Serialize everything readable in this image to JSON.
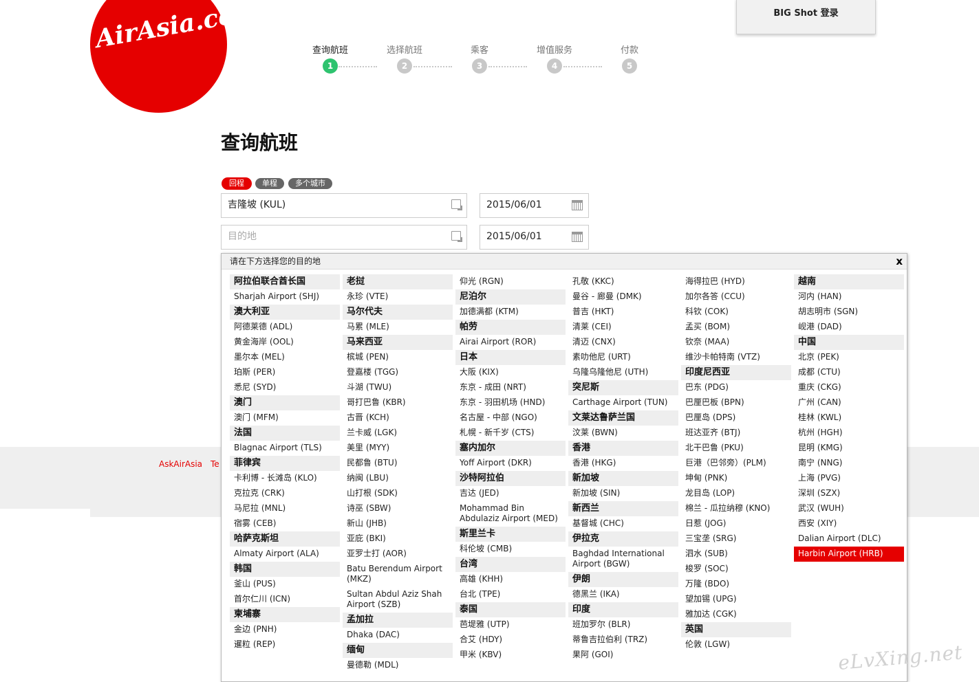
{
  "logo_text": "AirAsia.com",
  "big_shot_button": "BIG Shot 登录",
  "steps": [
    {
      "label": "查询航班",
      "num": "1",
      "active": true
    },
    {
      "label": "选择航班",
      "num": "2",
      "active": false
    },
    {
      "label": "乘客",
      "num": "3",
      "active": false
    },
    {
      "label": "增值服务",
      "num": "4",
      "active": false
    },
    {
      "label": "付款",
      "num": "5",
      "active": false
    }
  ],
  "page_title": "查询航班",
  "trip_types": [
    {
      "label": "回程",
      "active": true
    },
    {
      "label": "单程",
      "active": false
    },
    {
      "label": "多个城市",
      "active": false
    }
  ],
  "origin_value": "吉隆坡 (KUL)",
  "destination_placeholder": "目的地",
  "depart_date": "2015/06/01",
  "return_date": "2015/06/01",
  "footer_links": [
    "AskAirAsia",
    "Te"
  ],
  "dropdown": {
    "header": "请在下方选择您的目的地",
    "close": "x",
    "columns": [
      [
        {
          "text": "阿拉伯联合酋长国",
          "type": "country"
        },
        {
          "text": "Sharjah Airport (SHJ)",
          "type": "city"
        },
        {
          "text": "澳大利亚",
          "type": "country"
        },
        {
          "text": "阿德莱德 (ADL)",
          "type": "city"
        },
        {
          "text": "黄金海岸 (OOL)",
          "type": "city"
        },
        {
          "text": "墨尔本 (MEL)",
          "type": "city"
        },
        {
          "text": "珀斯 (PER)",
          "type": "city"
        },
        {
          "text": "悉尼 (SYD)",
          "type": "city"
        },
        {
          "text": "澳门",
          "type": "country"
        },
        {
          "text": "澳门 (MFM)",
          "type": "city"
        },
        {
          "text": "法国",
          "type": "country"
        },
        {
          "text": "Blagnac Airport (TLS)",
          "type": "city"
        },
        {
          "text": "菲律宾",
          "type": "country"
        },
        {
          "text": "卡利博 - 长滩岛 (KLO)",
          "type": "city"
        },
        {
          "text": "克拉克 (CRK)",
          "type": "city"
        },
        {
          "text": "马尼拉 (MNL)",
          "type": "city"
        },
        {
          "text": "宿雾 (CEB)",
          "type": "city"
        },
        {
          "text": "哈萨克斯坦",
          "type": "country"
        },
        {
          "text": "Almaty Airport (ALA)",
          "type": "city"
        },
        {
          "text": "韩国",
          "type": "country"
        },
        {
          "text": "釜山 (PUS)",
          "type": "city"
        },
        {
          "text": "首尔仁川 (ICN)",
          "type": "city"
        },
        {
          "text": "柬埔寨",
          "type": "country"
        },
        {
          "text": "金边 (PNH)",
          "type": "city"
        },
        {
          "text": "暹粒 (REP)",
          "type": "city"
        }
      ],
      [
        {
          "text": "老挝",
          "type": "country"
        },
        {
          "text": "永珍 (VTE)",
          "type": "city"
        },
        {
          "text": "马尔代夫",
          "type": "country"
        },
        {
          "text": "马累 (MLE)",
          "type": "city"
        },
        {
          "text": "马来西亚",
          "type": "country"
        },
        {
          "text": "槟城 (PEN)",
          "type": "city"
        },
        {
          "text": "登嘉楼 (TGG)",
          "type": "city"
        },
        {
          "text": "斗湖 (TWU)",
          "type": "city"
        },
        {
          "text": "哥打巴鲁 (KBR)",
          "type": "city"
        },
        {
          "text": "古晋 (KCH)",
          "type": "city"
        },
        {
          "text": "兰卡威 (LGK)",
          "type": "city"
        },
        {
          "text": "美里 (MYY)",
          "type": "city"
        },
        {
          "text": "民都鲁 (BTU)",
          "type": "city"
        },
        {
          "text": "纳闽 (LBU)",
          "type": "city"
        },
        {
          "text": "山打根 (SDK)",
          "type": "city"
        },
        {
          "text": "诗巫 (SBW)",
          "type": "city"
        },
        {
          "text": "新山 (JHB)",
          "type": "city"
        },
        {
          "text": "亚庇 (BKI)",
          "type": "city"
        },
        {
          "text": "亚罗士打 (AOR)",
          "type": "city"
        },
        {
          "text": "Batu Berendum Airport (MKZ)",
          "type": "city"
        },
        {
          "text": "Sultan Abdul Aziz Shah Airport (SZB)",
          "type": "city"
        },
        {
          "text": "孟加拉",
          "type": "country"
        },
        {
          "text": "Dhaka (DAC)",
          "type": "city"
        },
        {
          "text": "缅甸",
          "type": "country"
        },
        {
          "text": "曼德勒 (MDL)",
          "type": "city"
        }
      ],
      [
        {
          "text": "仰光 (RGN)",
          "type": "city"
        },
        {
          "text": "尼泊尔",
          "type": "country"
        },
        {
          "text": "加德满都 (KTM)",
          "type": "city"
        },
        {
          "text": "帕劳",
          "type": "country"
        },
        {
          "text": "Airai Airport (ROR)",
          "type": "city"
        },
        {
          "text": "日本",
          "type": "country"
        },
        {
          "text": "大阪 (KIX)",
          "type": "city"
        },
        {
          "text": "东京 - 成田 (NRT)",
          "type": "city"
        },
        {
          "text": "东京 - 羽田机场 (HND)",
          "type": "city"
        },
        {
          "text": "名古屋 - 中部 (NGO)",
          "type": "city"
        },
        {
          "text": "札幌 - 新千岁 (CTS)",
          "type": "city"
        },
        {
          "text": "塞内加尔",
          "type": "country"
        },
        {
          "text": "Yoff Airport (DKR)",
          "type": "city"
        },
        {
          "text": "沙特阿拉伯",
          "type": "country"
        },
        {
          "text": "吉达 (JED)",
          "type": "city"
        },
        {
          "text": "Mohammad Bin Abdulaziz Airport (MED)",
          "type": "city"
        },
        {
          "text": "斯里兰卡",
          "type": "country"
        },
        {
          "text": "科伦坡 (CMB)",
          "type": "city"
        },
        {
          "text": "台湾",
          "type": "country"
        },
        {
          "text": "高雄 (KHH)",
          "type": "city"
        },
        {
          "text": "台北 (TPE)",
          "type": "city"
        },
        {
          "text": "泰国",
          "type": "country"
        },
        {
          "text": "芭堤雅 (UTP)",
          "type": "city"
        },
        {
          "text": "合艾 (HDY)",
          "type": "city"
        },
        {
          "text": "甲米 (KBV)",
          "type": "city"
        }
      ],
      [
        {
          "text": "孔敬 (KKC)",
          "type": "city"
        },
        {
          "text": "曼谷 - 廊曼 (DMK)",
          "type": "city"
        },
        {
          "text": "普吉 (HKT)",
          "type": "city"
        },
        {
          "text": "清莱 (CEI)",
          "type": "city"
        },
        {
          "text": "清迈 (CNX)",
          "type": "city"
        },
        {
          "text": "素叻他尼 (URT)",
          "type": "city"
        },
        {
          "text": "乌隆乌隆他尼 (UTH)",
          "type": "city"
        },
        {
          "text": "突尼斯",
          "type": "country"
        },
        {
          "text": "Carthage Airport (TUN)",
          "type": "city"
        },
        {
          "text": "文莱达鲁萨兰国",
          "type": "country"
        },
        {
          "text": "汶莱 (BWN)",
          "type": "city"
        },
        {
          "text": "香港",
          "type": "country"
        },
        {
          "text": "香港 (HKG)",
          "type": "city"
        },
        {
          "text": "新加坡",
          "type": "country"
        },
        {
          "text": "新加坡 (SIN)",
          "type": "city"
        },
        {
          "text": "新西兰",
          "type": "country"
        },
        {
          "text": "基督城 (CHC)",
          "type": "city"
        },
        {
          "text": "伊拉克",
          "type": "country"
        },
        {
          "text": "Baghdad International Airport (BGW)",
          "type": "city"
        },
        {
          "text": "伊朗",
          "type": "country"
        },
        {
          "text": "德黑兰 (IKA)",
          "type": "city"
        },
        {
          "text": "印度",
          "type": "country"
        },
        {
          "text": "班加罗尔 (BLR)",
          "type": "city"
        },
        {
          "text": "蒂鲁吉拉伯利 (TRZ)",
          "type": "city"
        },
        {
          "text": "果阿 (GOI)",
          "type": "city"
        }
      ],
      [
        {
          "text": "海得拉巴 (HYD)",
          "type": "city"
        },
        {
          "text": "加尔各答 (CCU)",
          "type": "city"
        },
        {
          "text": "科钦 (COK)",
          "type": "city"
        },
        {
          "text": "孟买 (BOM)",
          "type": "city"
        },
        {
          "text": "钦奈 (MAA)",
          "type": "city"
        },
        {
          "text": "维沙卡帕特南 (VTZ)",
          "type": "city"
        },
        {
          "text": "印度尼西亚",
          "type": "country"
        },
        {
          "text": "巴东 (PDG)",
          "type": "city"
        },
        {
          "text": "巴厘巴板 (BPN)",
          "type": "city"
        },
        {
          "text": "巴厘岛 (DPS)",
          "type": "city"
        },
        {
          "text": "班达亚齐 (BTJ)",
          "type": "city"
        },
        {
          "text": "北干巴鲁 (PKU)",
          "type": "city"
        },
        {
          "text": "巨港（巴邻旁）(PLM)",
          "type": "city"
        },
        {
          "text": "坤甸 (PNK)",
          "type": "city"
        },
        {
          "text": "龙目岛 (LOP)",
          "type": "city"
        },
        {
          "text": "棉兰 - 瓜拉纳穆 (KNO)",
          "type": "city"
        },
        {
          "text": "日惹 (JOG)",
          "type": "city"
        },
        {
          "text": "三宝垄 (SRG)",
          "type": "city"
        },
        {
          "text": "泗水 (SUB)",
          "type": "city"
        },
        {
          "text": "梭罗 (SOC)",
          "type": "city"
        },
        {
          "text": "万隆 (BDO)",
          "type": "city"
        },
        {
          "text": "望加锡 (UPG)",
          "type": "city"
        },
        {
          "text": "雅加达 (CGK)",
          "type": "city"
        },
        {
          "text": "英国",
          "type": "country"
        },
        {
          "text": "伦敦 (LGW)",
          "type": "city"
        }
      ],
      [
        {
          "text": "越南",
          "type": "country"
        },
        {
          "text": "河内 (HAN)",
          "type": "city"
        },
        {
          "text": "胡志明市 (SGN)",
          "type": "city"
        },
        {
          "text": "岘港 (DAD)",
          "type": "city"
        },
        {
          "text": "中国",
          "type": "country"
        },
        {
          "text": "北京 (PEK)",
          "type": "city"
        },
        {
          "text": "成都 (CTU)",
          "type": "city"
        },
        {
          "text": "重庆 (CKG)",
          "type": "city"
        },
        {
          "text": "广州 (CAN)",
          "type": "city"
        },
        {
          "text": "桂林 (KWL)",
          "type": "city"
        },
        {
          "text": "杭州 (HGH)",
          "type": "city"
        },
        {
          "text": "昆明 (KMG)",
          "type": "city"
        },
        {
          "text": "南宁 (NNG)",
          "type": "city"
        },
        {
          "text": "上海 (PVG)",
          "type": "city"
        },
        {
          "text": "深圳 (SZX)",
          "type": "city"
        },
        {
          "text": "武汉 (WUH)",
          "type": "city"
        },
        {
          "text": "西安 (XIY)",
          "type": "city"
        },
        {
          "text": "Dalian Airport (DLC)",
          "type": "city"
        },
        {
          "text": "Harbin Airport (HRB)",
          "type": "city",
          "selected": true
        }
      ]
    ]
  },
  "watermark": "eLvXing.net"
}
